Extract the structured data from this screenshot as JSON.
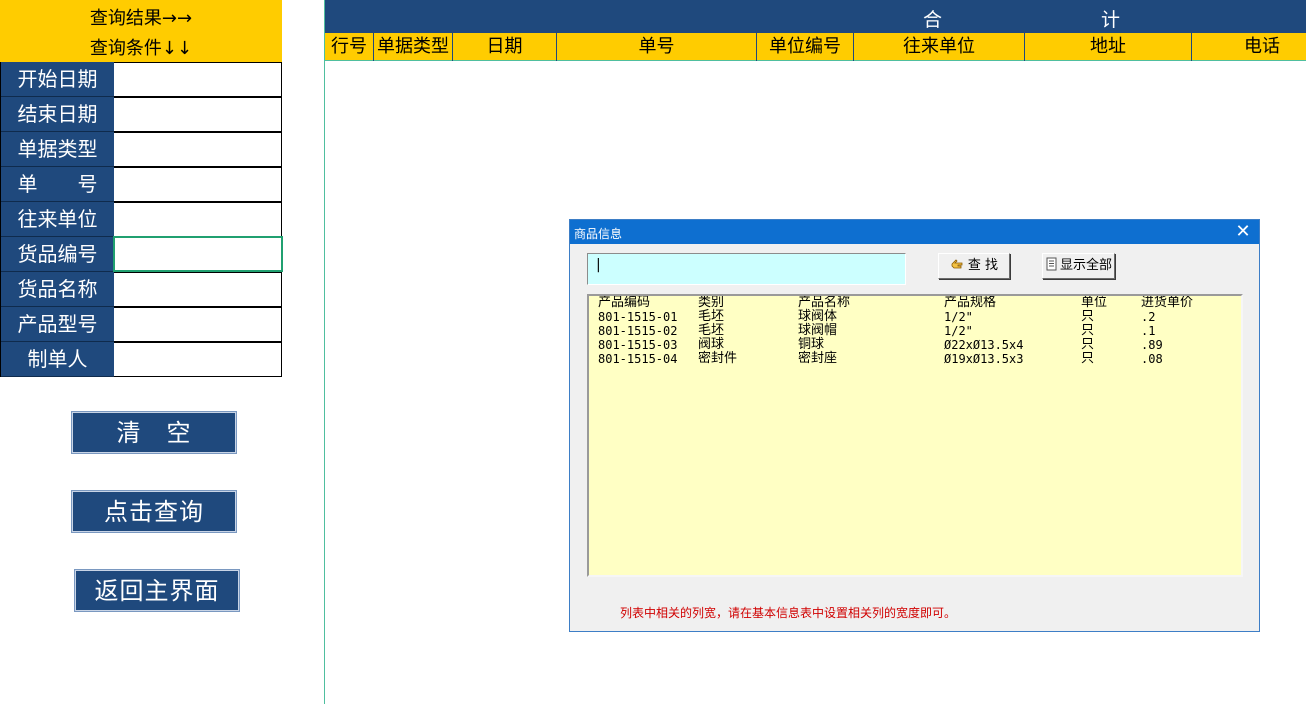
{
  "sheet": {
    "query_results_label": "查询结果→→",
    "query_conditions_label": "查询条件↓↓",
    "total_label_1": "合",
    "total_label_2": "计",
    "columns": [
      "行号",
      "单据类型",
      "日期",
      "单号",
      "单位编号",
      "往来单位",
      "地址",
      "电话"
    ]
  },
  "criteria": {
    "labels": [
      "开始日期",
      "结束日期",
      "单据类型",
      "单　　号",
      "往来单位",
      "货品编号",
      "货品名称",
      "产品型号",
      "制单人"
    ],
    "values": [
      "",
      "",
      "",
      "",
      "",
      "",
      "",
      "",
      ""
    ]
  },
  "buttons": {
    "clear": "清　空",
    "query": "点击查询",
    "back": "返回主界面"
  },
  "dialog": {
    "title": "商品信息",
    "search_value": "|",
    "find_label": "查 找",
    "show_all_label": "显示全部",
    "list_headers": [
      "产品编码",
      "类别",
      "产品名称",
      "产品规格",
      "单位",
      "进货单价"
    ],
    "rows": [
      [
        "801-1515-01",
        "毛坯",
        "球阀体",
        "1/2\"",
        "只",
        ".2"
      ],
      [
        "801-1515-02",
        "毛坯",
        "球阀帽",
        "1/2\"",
        "只",
        ".1"
      ],
      [
        "801-1515-03",
        "阀球",
        "铜球",
        "Ø22xØ13.5x4",
        "只",
        ".89"
      ],
      [
        "801-1515-04",
        "密封件",
        "密封座",
        "Ø19xØ13.5x3",
        "只",
        ".08"
      ]
    ],
    "note": "列表中相关的列宽，请在基本信息表中设置相关列的宽度即可。"
  },
  "colors": {
    "navy": "#1f497d",
    "yellow": "#ffcc00",
    "dialog_title": "#0e6fd0",
    "list_bg": "#ffffc4",
    "search_bg": "#ccffff",
    "note": "#d00000"
  }
}
